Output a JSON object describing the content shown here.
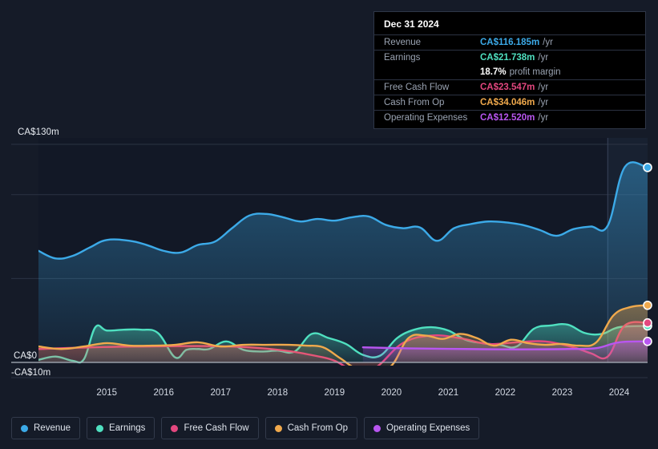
{
  "chart_data": {
    "type": "area",
    "title": "",
    "currency": "CA$",
    "units": "m",
    "xlabel": "",
    "ylabel": "",
    "ylim": [
      -10,
      130
    ],
    "grid": true,
    "gridlines": [
      130,
      100,
      50,
      0
    ],
    "y_axis_labels": {
      "top": "CA$130m",
      "zero": "CA$0",
      "bottom": "-CA$10m"
    },
    "x_tick_labels": [
      "2015",
      "2016",
      "2017",
      "2018",
      "2019",
      "2020",
      "2021",
      "2022",
      "2023",
      "2024"
    ],
    "x_start": 2014.3,
    "x_end": 2025.0,
    "forecast_divider_year": 2024.3,
    "legend_position": "bottom",
    "series": [
      {
        "name": "Revenue",
        "color": "#3caae8",
        "x": [
          2014.3,
          2014.6,
          2014.9,
          2015.2,
          2015.5,
          2015.9,
          2016.2,
          2016.5,
          2016.8,
          2017.1,
          2017.4,
          2017.7,
          2018.0,
          2018.3,
          2018.6,
          2018.9,
          2019.2,
          2019.5,
          2019.8,
          2020.1,
          2020.4,
          2020.7,
          2021.0,
          2021.3,
          2021.6,
          2021.9,
          2022.2,
          2022.5,
          2022.8,
          2023.1,
          2023.4,
          2023.7,
          2024.0,
          2024.3,
          2024.6,
          2025.0
        ],
        "values": [
          66.5,
          62.0,
          63.5,
          68.5,
          73.0,
          72.5,
          70.0,
          66.5,
          65.5,
          70.0,
          72.0,
          80.0,
          87.5,
          88.5,
          86.5,
          84.0,
          85.5,
          84.5,
          86.5,
          87.0,
          82.0,
          80.0,
          80.5,
          72.5,
          80.0,
          82.5,
          84.0,
          83.5,
          82.0,
          79.0,
          75.5,
          79.5,
          81.0,
          81.5,
          116.5,
          116.185
        ]
      },
      {
        "name": "Earnings",
        "color": "#4fe0c0",
        "x": [
          2014.3,
          2014.6,
          2014.9,
          2015.1,
          2015.3,
          2015.5,
          2015.8,
          2016.1,
          2016.4,
          2016.7,
          2016.9,
          2017.1,
          2017.3,
          2017.6,
          2017.9,
          2018.2,
          2018.5,
          2018.8,
          2019.1,
          2019.4,
          2019.7,
          2020.0,
          2020.3,
          2020.6,
          2020.9,
          2021.2,
          2021.5,
          2021.8,
          2022.1,
          2022.4,
          2022.7,
          2023.0,
          2023.3,
          2023.6,
          2023.9,
          2024.2,
          2024.5,
          2025.0
        ],
        "values": [
          1.5,
          3.5,
          1.0,
          2.0,
          21.0,
          19.0,
          19.5,
          19.5,
          17.5,
          3.0,
          7.5,
          8.0,
          8.0,
          12.5,
          7.5,
          6.5,
          7.0,
          6.5,
          17.0,
          14.5,
          11.0,
          4.5,
          4.0,
          14.5,
          19.5,
          21.0,
          19.0,
          13.5,
          11.5,
          10.5,
          9.5,
          20.0,
          22.0,
          22.5,
          17.5,
          17.0,
          21.0,
          21.738
        ]
      },
      {
        "name": "Free Cash Flow",
        "color": "#e3477f",
        "x": [
          2014.3,
          2016.0,
          2018.0,
          2019.3,
          2019.8,
          2020.2,
          2020.7,
          2021.2,
          2021.7,
          2022.2,
          2022.7,
          2023.2,
          2023.7,
          2024.0,
          2024.3,
          2024.6,
          2025.0
        ],
        "values": [
          8.0,
          9.5,
          9.0,
          3.0,
          -4.0,
          -3.5,
          11.5,
          16.0,
          14.5,
          11.0,
          12.0,
          12.5,
          9.0,
          5.5,
          3.5,
          22.0,
          23.547
        ]
      },
      {
        "name": "Cash From Op",
        "color": "#f0a94c",
        "x": [
          2014.3,
          2014.7,
          2015.1,
          2015.5,
          2015.9,
          2016.3,
          2016.7,
          2017.1,
          2017.5,
          2017.9,
          2018.3,
          2018.7,
          2019.0,
          2019.3,
          2019.6,
          2019.9,
          2020.2,
          2020.5,
          2020.8,
          2021.1,
          2021.4,
          2021.7,
          2022.0,
          2022.3,
          2022.6,
          2022.9,
          2023.2,
          2023.5,
          2023.8,
          2024.1,
          2024.4,
          2024.7,
          2025.0
        ],
        "values": [
          9.5,
          8.0,
          9.5,
          11.5,
          10.0,
          10.0,
          10.5,
          12.0,
          9.5,
          10.5,
          10.5,
          10.5,
          10.0,
          9.0,
          2.5,
          -4.0,
          -4.5,
          -2.0,
          14.5,
          16.0,
          14.0,
          17.0,
          14.5,
          10.0,
          13.5,
          11.5,
          10.5,
          11.0,
          10.0,
          12.0,
          28.0,
          33.0,
          34.046
        ]
      },
      {
        "name": "Operating Expenses",
        "color": "#b856f0",
        "x": [
          2020.0,
          2020.6,
          2021.2,
          2021.8,
          2022.4,
          2023.0,
          2023.6,
          2024.1,
          2024.5,
          2025.0
        ],
        "values": [
          9.0,
          8.5,
          8.2,
          8.0,
          7.8,
          7.8,
          8.0,
          8.5,
          12.0,
          12.52
        ]
      }
    ]
  },
  "tooltip": {
    "date": "Dec 31 2024",
    "rows": [
      {
        "key": "Revenue",
        "value": "CA$116.185m",
        "unit": "/yr",
        "color": "#3caae8"
      },
      {
        "key": "Earnings",
        "value": "CA$21.738m",
        "unit": "/yr",
        "color": "#4fe0c0"
      },
      {
        "key": "Free Cash Flow",
        "value": "CA$23.547m",
        "unit": "/yr",
        "color": "#e3477f"
      },
      {
        "key": "Cash From Op",
        "value": "CA$34.046m",
        "unit": "/yr",
        "color": "#f0a94c"
      },
      {
        "key": "Operating Expenses",
        "value": "CA$12.520m",
        "unit": "/yr",
        "color": "#b856f0"
      }
    ],
    "profit_margin_value": "18.7%",
    "profit_margin_label": "profit margin"
  },
  "legend": {
    "items": [
      {
        "label": "Revenue",
        "color": "#3caae8"
      },
      {
        "label": "Earnings",
        "color": "#4fe0c0"
      },
      {
        "label": "Free Cash Flow",
        "color": "#e3477f"
      },
      {
        "label": "Cash From Op",
        "color": "#f0a94c"
      },
      {
        "label": "Operating Expenses",
        "color": "#b856f0"
      }
    ]
  },
  "theme": {
    "background": "#151b28",
    "gridline": "#2b3343",
    "zero_line": "#aab2bd"
  }
}
